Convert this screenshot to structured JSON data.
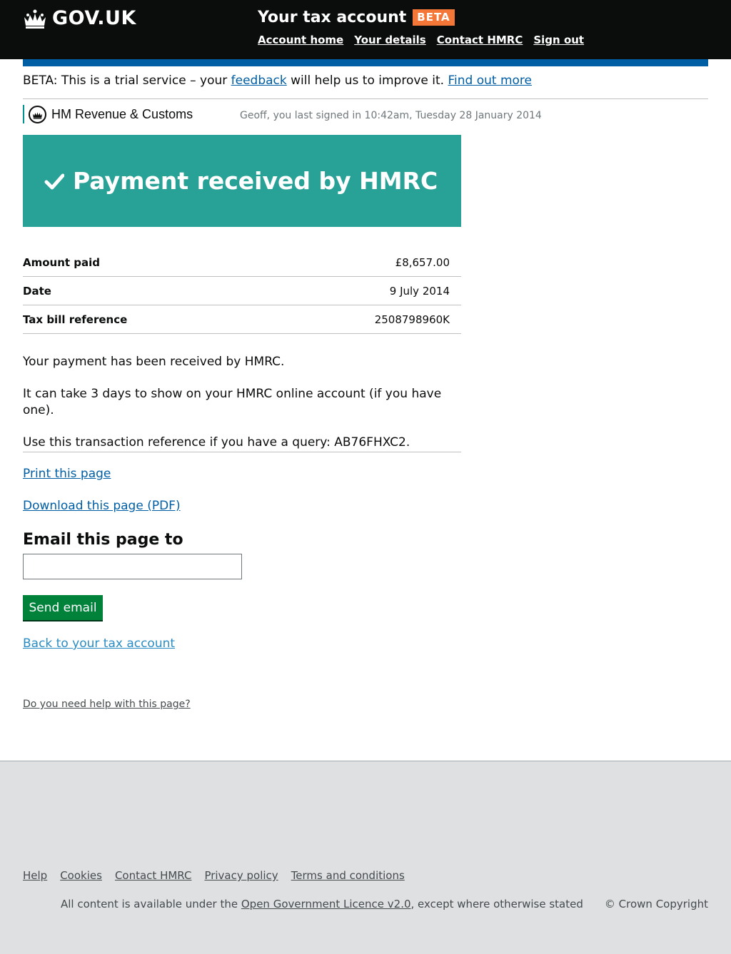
{
  "header": {
    "logo_text": "GOV.UK",
    "service_name": "Your tax account",
    "beta_tag": "BETA",
    "nav": [
      "Account home",
      "Your details",
      "Contact HMRC",
      "Sign out"
    ]
  },
  "beta_banner": {
    "prefix": "BETA: This is a trial service – your ",
    "feedback_link": "feedback",
    "middle": " will help us to improve it. ",
    "find_out_link": "Find out more"
  },
  "org": {
    "name": "HM Revenue & Customs",
    "last_signed_in": "Geoff, you last signed in 10:42am, Tuesday 28 January 2014"
  },
  "confirmation": {
    "title": "Payment received by HMRC"
  },
  "summary": [
    {
      "key": "Amount paid",
      "value": "£8,657.00"
    },
    {
      "key": "Date",
      "value": "9 July 2014"
    },
    {
      "key": "Tax bill reference",
      "value": "2508798960K"
    }
  ],
  "body": [
    "Your payment has been received by HMRC.",
    "It can take 3 days to show on your HMRC online account (if you have one).",
    "Use this transaction reference if you have a query: AB76FHXC2."
  ],
  "actions": {
    "print": "Print this page",
    "download": "Download this page (PDF)",
    "email_heading": "Email this page to",
    "email_value": "",
    "send_button": "Send email",
    "back": "Back to your tax account",
    "help": "Do you need help with this page?"
  },
  "footer": {
    "links": [
      "Help",
      "Cookies",
      "Contact HMRC",
      "Privacy policy",
      "Terms and conditions"
    ],
    "licence_prefix": "All content is available under the ",
    "licence_link": "Open Government Licence v2.0",
    "licence_suffix": ", except where otherwise stated",
    "copyright": "© Crown Copyright"
  },
  "colors": {
    "header_bg": "#0b0c0c",
    "beta_tag": "#f47738",
    "brand_blue": "#005ea5",
    "panel_green": "#28a197",
    "button_green": "#00823b",
    "footer_bg": "#dee0e2"
  },
  "icons": {
    "logo": "crown-icon",
    "org": "hmrc-crest-icon",
    "panel": "tick-icon"
  }
}
